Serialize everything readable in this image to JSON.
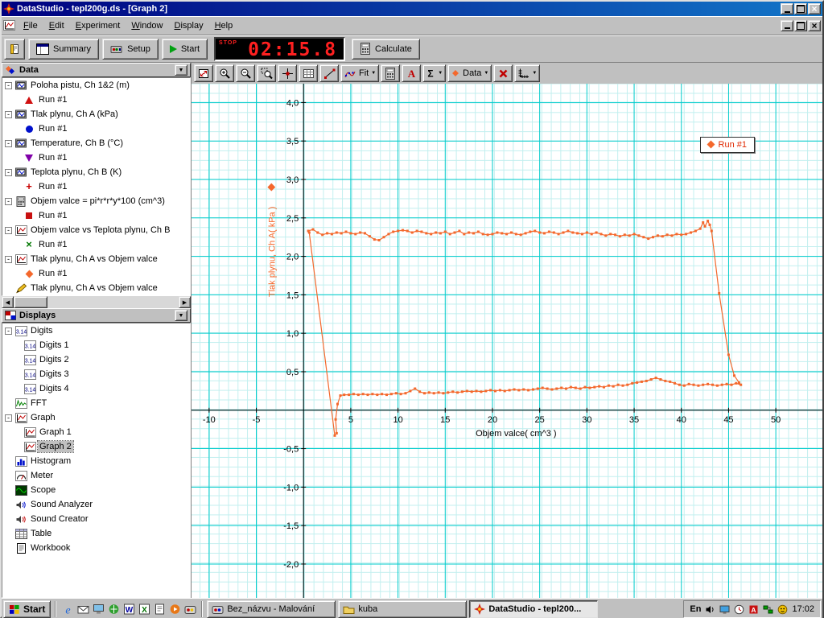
{
  "titlebar": {
    "title": "DataStudio - tepl200g.ds - [Graph 2]"
  },
  "menubar": {
    "items": [
      "File",
      "Edit",
      "Experiment",
      "Window",
      "Display",
      "Help"
    ]
  },
  "toolbar": {
    "summary_label": "Summary",
    "setup_label": "Setup",
    "start_label": "Start",
    "timer": {
      "stop_label": "STOP",
      "value": "02:15.8"
    },
    "calculate_label": "Calculate"
  },
  "graph_toolbar": {
    "buttons": [
      {
        "name": "scale-to-fit-button",
        "icon": "scale-to-fit-icon"
      },
      {
        "name": "zoom-in-button",
        "icon": "zoom-in-icon"
      },
      {
        "name": "zoom-out-button",
        "icon": "zoom-out-icon"
      },
      {
        "name": "zoom-select-button",
        "icon": "zoom-select-icon"
      },
      {
        "name": "smart-tool-button",
        "icon": "smart-tool-icon"
      },
      {
        "name": "grid-tool-button",
        "icon": "grid-tool-icon"
      },
      {
        "name": "slope-tool-button",
        "icon": "slope-tool-icon"
      },
      {
        "name": "fit-menu-button",
        "icon": "fit-icon",
        "label": "Fit",
        "dropdown": true
      },
      {
        "name": "calculator-button",
        "icon": "calculator-icon"
      },
      {
        "name": "text-annotation-button",
        "icon": "text-icon"
      },
      {
        "name": "statistics-button",
        "icon": "sigma-icon",
        "dropdown": true
      },
      {
        "name": "data-menu-button",
        "icon": "run-marker-icon",
        "label": "Data",
        "dropdown": true
      },
      {
        "name": "remove-button",
        "icon": "delete-icon"
      },
      {
        "name": "graph-settings-button",
        "icon": "axes-settings-icon",
        "dropdown": true
      }
    ]
  },
  "data_panel": {
    "title": "Data",
    "items": [
      {
        "type": "group",
        "icon": "sensor-icon",
        "label": "Poloha pistu, Ch 1&2 (m)"
      },
      {
        "type": "run",
        "marker": "triangle-red",
        "label": "Run #1"
      },
      {
        "type": "group",
        "icon": "sensor-icon",
        "label": "Tlak plynu, Ch A (kPa)"
      },
      {
        "type": "run",
        "marker": "circle-blue",
        "label": "Run #1"
      },
      {
        "type": "group",
        "icon": "sensor-icon",
        "label": "Temperature, Ch B (°C)"
      },
      {
        "type": "run",
        "marker": "triangle-down-purple",
        "label": "Run #1"
      },
      {
        "type": "group",
        "icon": "sensor-icon",
        "label": "Teplota plynu, Ch B (K)"
      },
      {
        "type": "run",
        "marker": "plus-red",
        "label": "Run #1"
      },
      {
        "type": "group",
        "icon": "calc-data-icon",
        "label": "Objem valce = pi*r*r*y*100 (cm^3)"
      },
      {
        "type": "run",
        "marker": "square-red",
        "label": "Run #1"
      },
      {
        "type": "group",
        "icon": "graph-data-icon",
        "label": "Objem valce vs Teplota plynu, Ch B"
      },
      {
        "type": "run",
        "marker": "x-green",
        "label": "Run #1"
      },
      {
        "type": "group",
        "icon": "graph-data-icon",
        "label": "Tlak plynu, Ch A vs Objem valce"
      },
      {
        "type": "run",
        "marker": "diamond-orange",
        "label": "Run #1"
      },
      {
        "type": "group",
        "icon": "pencil-icon",
        "label": "Tlak plynu, Ch A vs Objem valce",
        "expand": false
      }
    ]
  },
  "displays_panel": {
    "title": "Displays",
    "items": [
      {
        "icon": "digits-icon",
        "label": "Digits",
        "level": 0,
        "expand": true
      },
      {
        "icon": "digits-icon",
        "label": "Digits 1",
        "level": 1
      },
      {
        "icon": "digits-icon",
        "label": "Digits 2",
        "level": 1
      },
      {
        "icon": "digits-icon",
        "label": "Digits 3",
        "level": 1
      },
      {
        "icon": "digits-icon",
        "label": "Digits 4",
        "level": 1
      },
      {
        "icon": "fft-icon",
        "label": "FFT",
        "level": 0
      },
      {
        "icon": "graph-icon",
        "label": "Graph",
        "level": 0,
        "expand": true
      },
      {
        "icon": "graph-icon",
        "label": "Graph 1",
        "level": 1
      },
      {
        "icon": "graph-icon",
        "label": "Graph 2",
        "level": 1,
        "selected": true
      },
      {
        "icon": "histogram-icon",
        "label": "Histogram",
        "level": 0
      },
      {
        "icon": "meter-icon",
        "label": "Meter",
        "level": 0
      },
      {
        "icon": "scope-icon",
        "label": "Scope",
        "level": 0
      },
      {
        "icon": "sound-analyzer-icon",
        "label": "Sound Analyzer",
        "level": 0
      },
      {
        "icon": "sound-creator-icon",
        "label": "Sound Creator",
        "level": 0
      },
      {
        "icon": "table-icon",
        "label": "Table",
        "level": 0
      },
      {
        "icon": "workbook-icon",
        "label": "Workbook",
        "level": 0
      }
    ]
  },
  "taskbar": {
    "start_label": "Start",
    "quick_launch": [
      {
        "name": "ie-icon"
      },
      {
        "name": "outlook-express-icon"
      },
      {
        "name": "show-desktop-icon"
      },
      {
        "name": "channels-icon"
      },
      {
        "name": "word-icon"
      },
      {
        "name": "excel-icon"
      },
      {
        "name": "notepad-icon"
      },
      {
        "name": "media-player-icon"
      },
      {
        "name": "paint-ql-icon"
      }
    ],
    "tasks": [
      {
        "label": "Bez_názvu - Malování",
        "icon": "paint-icon",
        "active": false
      },
      {
        "label": "kuba",
        "icon": "folder-icon",
        "active": false
      },
      {
        "label": "DataStudio - tepl200...",
        "icon": "datastudio-icon",
        "active": true
      }
    ],
    "tray": {
      "lang": "En",
      "icons": [
        {
          "name": "volume-icon"
        },
        {
          "name": "display-settings-icon"
        },
        {
          "name": "scheduler-icon"
        },
        {
          "name": "antivirus-icon"
        },
        {
          "name": "network-icon"
        },
        {
          "name": "messenger-icon"
        }
      ],
      "time": "17:02"
    }
  },
  "chart_data": {
    "type": "scatter",
    "title": "",
    "xlabel": "Objem valce( cm^3 )",
    "ylabel": "Tlak plynu, Ch A( kPa )",
    "xlim": [
      -11.86,
      54.93
    ],
    "ylim": [
      -2.44,
      4.245
    ],
    "x_ticks": [
      -10,
      -5,
      5,
      10,
      15,
      20,
      25,
      30,
      35,
      40,
      45,
      50
    ],
    "x_tick_labels": [
      "-10",
      "-5",
      "5",
      "10",
      "15",
      "20",
      "25",
      "30",
      "35",
      "40",
      "45",
      "50"
    ],
    "y_ticks": [
      -2,
      -1.5,
      -1,
      -0.5,
      0.5,
      1,
      1.5,
      2,
      2.5,
      3,
      3.5,
      4
    ],
    "y_tick_labels": [
      "-2,0",
      "-1,5",
      "-1,0",
      "-0,5",
      "0,5",
      "1,0",
      "1,5",
      "2,0",
      "2,5",
      "3,0",
      "3,5",
      "4,0"
    ],
    "grid": {
      "major_color": "#00cccc",
      "minor_color": "#c2efef",
      "major_x_step": 5,
      "major_y_step": 0.5
    },
    "legend": {
      "label": "Run #1",
      "text_color": "#e02800",
      "position": "top-right"
    },
    "series": [
      {
        "name": "Run #1",
        "color": "#f4682c",
        "points": [
          [
            0.5,
            2.33
          ],
          [
            1,
            2.35
          ],
          [
            1.5,
            2.31
          ],
          [
            2,
            2.28
          ],
          [
            2.5,
            2.3
          ],
          [
            3,
            2.29
          ],
          [
            3.5,
            2.31
          ],
          [
            4,
            2.3
          ],
          [
            4.5,
            2.32
          ],
          [
            5,
            2.3
          ],
          [
            5.5,
            2.29
          ],
          [
            6,
            2.31
          ],
          [
            6.5,
            2.3
          ],
          [
            7,
            2.26
          ],
          [
            7.5,
            2.22
          ],
          [
            8,
            2.21
          ],
          [
            8.5,
            2.25
          ],
          [
            9,
            2.29
          ],
          [
            9.5,
            2.32
          ],
          [
            10,
            2.33
          ],
          [
            10.5,
            2.34
          ],
          [
            11,
            2.33
          ],
          [
            11.5,
            2.31
          ],
          [
            12,
            2.33
          ],
          [
            12.5,
            2.32
          ],
          [
            13,
            2.3
          ],
          [
            13.5,
            2.29
          ],
          [
            14,
            2.31
          ],
          [
            14.5,
            2.3
          ],
          [
            15,
            2.32
          ],
          [
            15.5,
            2.29
          ],
          [
            16,
            2.31
          ],
          [
            16.5,
            2.33
          ],
          [
            17,
            2.29
          ],
          [
            17.5,
            2.31
          ],
          [
            18,
            2.3
          ],
          [
            18.5,
            2.32
          ],
          [
            19,
            2.29
          ],
          [
            19.5,
            2.28
          ],
          [
            20,
            2.29
          ],
          [
            20.5,
            2.31
          ],
          [
            21,
            2.3
          ],
          [
            21.5,
            2.29
          ],
          [
            22,
            2.31
          ],
          [
            22.5,
            2.29
          ],
          [
            23,
            2.28
          ],
          [
            23.5,
            2.3
          ],
          [
            24,
            2.32
          ],
          [
            24.5,
            2.33
          ],
          [
            25,
            2.31
          ],
          [
            25.5,
            2.3
          ],
          [
            26,
            2.32
          ],
          [
            26.5,
            2.31
          ],
          [
            27,
            2.29
          ],
          [
            27.5,
            2.31
          ],
          [
            28,
            2.33
          ],
          [
            28.5,
            2.31
          ],
          [
            29,
            2.3
          ],
          [
            29.5,
            2.29
          ],
          [
            30,
            2.31
          ],
          [
            30.5,
            2.29
          ],
          [
            31,
            2.31
          ],
          [
            31.5,
            2.29
          ],
          [
            32,
            2.27
          ],
          [
            32.5,
            2.29
          ],
          [
            33,
            2.28
          ],
          [
            33.5,
            2.26
          ],
          [
            34,
            2.28
          ],
          [
            34.5,
            2.27
          ],
          [
            35,
            2.29
          ],
          [
            35.5,
            2.27
          ],
          [
            36,
            2.25
          ],
          [
            36.5,
            2.23
          ],
          [
            37,
            2.25
          ],
          [
            37.5,
            2.27
          ],
          [
            38,
            2.26
          ],
          [
            38.5,
            2.28
          ],
          [
            39,
            2.27
          ],
          [
            39.5,
            2.29
          ],
          [
            40,
            2.28
          ],
          [
            40.5,
            2.29
          ],
          [
            41,
            2.31
          ],
          [
            41.5,
            2.33
          ],
          [
            42,
            2.36
          ],
          [
            42.3,
            2.44
          ],
          [
            42.5,
            2.39
          ],
          [
            42.8,
            2.46
          ],
          [
            43,
            2.41
          ],
          [
            43.2,
            2.33
          ],
          [
            44,
            1.52
          ],
          [
            45,
            0.72
          ],
          [
            45.6,
            0.45
          ],
          [
            46.1,
            0.36
          ],
          [
            46.3,
            0.33
          ],
          [
            45.8,
            0.35
          ],
          [
            45.3,
            0.33
          ],
          [
            44.8,
            0.34
          ],
          [
            44.3,
            0.33
          ],
          [
            43.8,
            0.32
          ],
          [
            43.3,
            0.33
          ],
          [
            42.8,
            0.34
          ],
          [
            42.3,
            0.33
          ],
          [
            41.8,
            0.32
          ],
          [
            41.3,
            0.33
          ],
          [
            40.8,
            0.34
          ],
          [
            40.3,
            0.32
          ],
          [
            39.8,
            0.33
          ],
          [
            39.3,
            0.35
          ],
          [
            38.8,
            0.37
          ],
          [
            38.3,
            0.38
          ],
          [
            37.8,
            0.4
          ],
          [
            37.3,
            0.42
          ],
          [
            36.8,
            0.4
          ],
          [
            36.3,
            0.38
          ],
          [
            35.8,
            0.37
          ],
          [
            35.3,
            0.36
          ],
          [
            34.8,
            0.35
          ],
          [
            34.3,
            0.33
          ],
          [
            33.8,
            0.32
          ],
          [
            33.3,
            0.33
          ],
          [
            32.8,
            0.31
          ],
          [
            32.3,
            0.32
          ],
          [
            31.8,
            0.3
          ],
          [
            31.3,
            0.31
          ],
          [
            30.8,
            0.3
          ],
          [
            30.3,
            0.29
          ],
          [
            29.8,
            0.3
          ],
          [
            29.3,
            0.28
          ],
          [
            28.8,
            0.29
          ],
          [
            28.3,
            0.3
          ],
          [
            27.8,
            0.28
          ],
          [
            27.3,
            0.29
          ],
          [
            26.8,
            0.28
          ],
          [
            26.3,
            0.27
          ],
          [
            25.8,
            0.28
          ],
          [
            25.3,
            0.29
          ],
          [
            24.8,
            0.28
          ],
          [
            24.3,
            0.27
          ],
          [
            23.8,
            0.26
          ],
          [
            23.3,
            0.27
          ],
          [
            22.8,
            0.26
          ],
          [
            22.3,
            0.27
          ],
          [
            21.8,
            0.26
          ],
          [
            21.3,
            0.25
          ],
          [
            20.8,
            0.26
          ],
          [
            20.3,
            0.25
          ],
          [
            19.8,
            0.26
          ],
          [
            19.3,
            0.25
          ],
          [
            18.8,
            0.24
          ],
          [
            18.3,
            0.25
          ],
          [
            17.8,
            0.24
          ],
          [
            17.3,
            0.25
          ],
          [
            16.8,
            0.24
          ],
          [
            16.3,
            0.23
          ],
          [
            15.8,
            0.24
          ],
          [
            15.3,
            0.23
          ],
          [
            14.8,
            0.22
          ],
          [
            14.3,
            0.23
          ],
          [
            13.8,
            0.22
          ],
          [
            13.3,
            0.23
          ],
          [
            12.8,
            0.22
          ],
          [
            12.3,
            0.24
          ],
          [
            11.8,
            0.28
          ],
          [
            11.3,
            0.25
          ],
          [
            10.8,
            0.22
          ],
          [
            10.3,
            0.21
          ],
          [
            9.8,
            0.22
          ],
          [
            9.3,
            0.21
          ],
          [
            8.8,
            0.2
          ],
          [
            8.3,
            0.21
          ],
          [
            7.8,
            0.2
          ],
          [
            7.3,
            0.21
          ],
          [
            6.8,
            0.2
          ],
          [
            6.3,
            0.21
          ],
          [
            5.8,
            0.2
          ],
          [
            5.3,
            0.21
          ],
          [
            4.8,
            0.2
          ],
          [
            4.3,
            0.2
          ],
          [
            3.9,
            0.19
          ],
          [
            3.6,
            0.08
          ],
          [
            3.4,
            -0.12
          ],
          [
            3.5,
            -0.3
          ],
          [
            3.3,
            -0.33
          ],
          [
            0.6,
            2.31
          ]
        ]
      }
    ]
  }
}
